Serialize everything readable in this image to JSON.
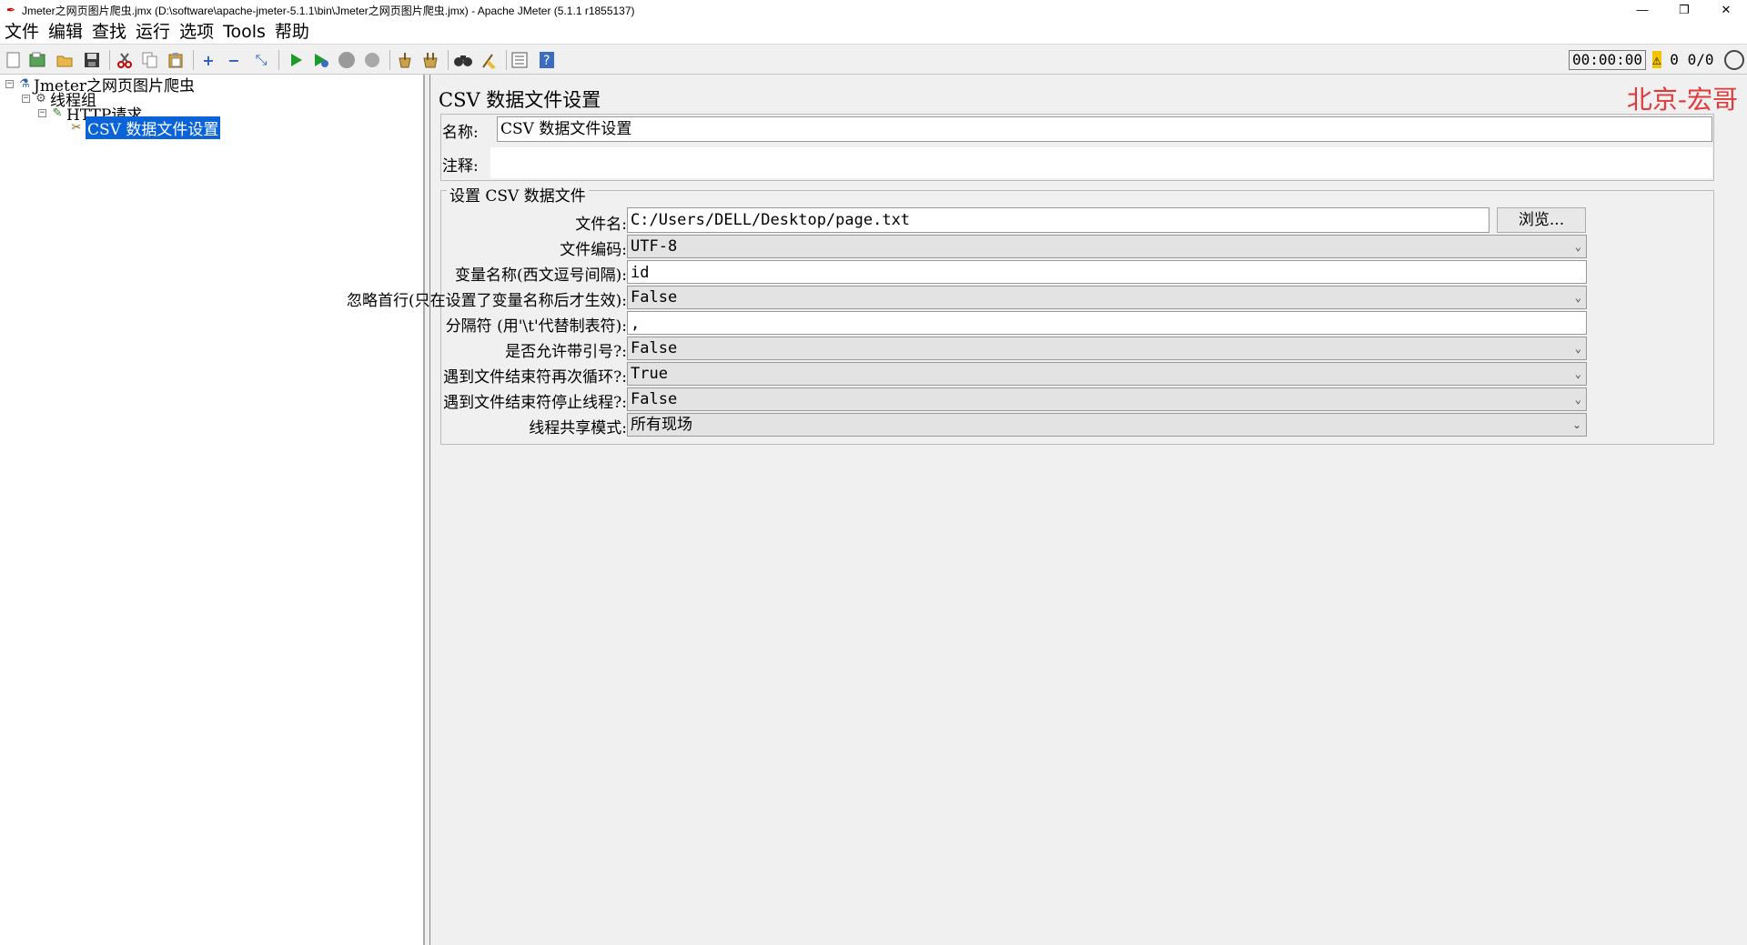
{
  "window": {
    "title": "Jmeter之网页图片爬虫.jmx (D:\\software\\apache-jmeter-5.1.1\\bin\\Jmeter之网页图片爬虫.jmx) - Apache JMeter (5.1.1 r1855137)",
    "minimize": "—",
    "restore": "❐",
    "close": "✕"
  },
  "menu": [
    "文件",
    "编辑",
    "查找",
    "运行",
    "选项",
    "Tools",
    "帮助"
  ],
  "toolbar": {
    "icons": [
      "new-icon",
      "templates-icon",
      "open-icon",
      "save-icon",
      "cut-icon",
      "copy-icon",
      "paste-icon",
      "expand-icon",
      "collapse-icon",
      "toggle-icon",
      "start-icon",
      "start-no-pause-icon",
      "stop-icon",
      "shutdown-icon",
      "clear-icon",
      "clear-all-icon",
      "search-icon",
      "reset-search-icon",
      "function-helper-icon",
      "help-icon"
    ],
    "timer": "00:00:00",
    "warnings": "0",
    "threads": "0/0"
  },
  "tree": {
    "root": "Jmeter之网页图片爬虫",
    "thread_group": "线程组",
    "http_request": "HTTP请求",
    "csv_config": "CSV 数据文件设置"
  },
  "panel": {
    "title": "CSV 数据文件设置",
    "watermark": "北京-宏哥",
    "name_label": "名称:",
    "name_value": "CSV 数据文件设置",
    "comment_label": "注释:",
    "comment_value": "",
    "group_title": "设置 CSV 数据文件",
    "filename_label": "文件名:",
    "filename_value": "C:/Users/DELL/Desktop/page.txt",
    "browse_label": "浏览...",
    "encoding_label": "文件编码:",
    "encoding_value": "UTF-8",
    "varnames_label": "变量名称(西文逗号间隔):",
    "varnames_value": "id",
    "ignore_first_label": "忽略首行(只在设置了变量名称后才生效):",
    "ignore_first_value": "False",
    "delimiter_label": "分隔符 (用'\\t'代替制表符):",
    "delimiter_value": ",",
    "quoted_label": "是否允许带引号?:",
    "quoted_value": "False",
    "recycle_label": "遇到文件结束符再次循环?:",
    "recycle_value": "True",
    "stop_thread_label": "遇到文件结束符停止线程?:",
    "stop_thread_value": "False",
    "sharing_label": "线程共享模式:",
    "sharing_value": "所有现场"
  }
}
